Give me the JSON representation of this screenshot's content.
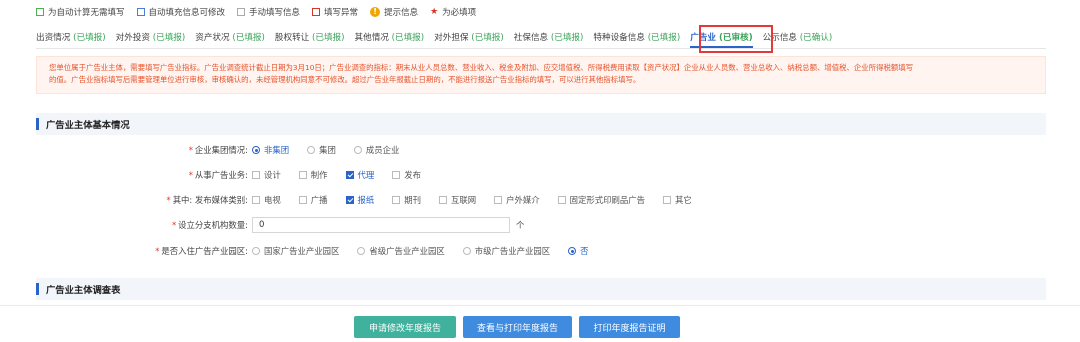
{
  "legend": {
    "auto_calc": "为自动计算无需填写",
    "auto_fill": "自动填充信息可修改",
    "manual": "手动填写信息",
    "error": "填写异常",
    "tip": "提示信息",
    "required": "为必填项"
  },
  "tabs": [
    {
      "name": "出资情况",
      "status": "(已填报)"
    },
    {
      "name": "对外投资",
      "status": "(已填报)"
    },
    {
      "name": "资产状况",
      "status": "(已填报)"
    },
    {
      "name": "股权转让",
      "status": "(已填报)"
    },
    {
      "name": "其他情况",
      "status": "(已填报)"
    },
    {
      "name": "对外担保",
      "status": "(已填报)"
    },
    {
      "name": "社保信息",
      "status": "(已填报)"
    },
    {
      "name": "特种设备信息",
      "status": "(已填报)"
    },
    {
      "name": "广告业",
      "status": "(已审核)"
    },
    {
      "name": "公示信息",
      "status": "(已确认)"
    }
  ],
  "notice": {
    "line1": "您单位属于广告业主体，需要填写广告业指标。广告业调查统计截止日期为3月10日；广告业调查的指标：期末从业人员总数、营业收入、税金及附加、应交增值税、所得税费用读取【资产状况】企业从业人员数、营业总收入、纳税总额、增值税、企业所得税额填写",
    "line2": "的值。广告业指标填写后需要管理单位进行审核，审核确认的，未经管理机构同意不可修改。超过广告业年报截止日期的，不能进行报送广告业指标的填写，可以进行其他指标填写。"
  },
  "section1": {
    "title": "广告业主体基本情况",
    "group": {
      "label": "企业集团情况:",
      "options": [
        "非集团",
        "集团",
        "成员企业"
      ]
    },
    "business": {
      "label": "从事广告业务:",
      "options": [
        "设计",
        "制作",
        "代理",
        "发布"
      ]
    },
    "media": {
      "label": "其中: 发布媒体类别:",
      "options": [
        "电视",
        "广播",
        "报纸",
        "期刊",
        "互联网",
        "户外媒介",
        "固定形式印刷品广告",
        "其它"
      ]
    },
    "branches": {
      "label": "设立分支机构数量:",
      "value": "0",
      "unit": "个"
    },
    "park": {
      "label": "是否入住广告产业园区:",
      "options": [
        "国家广告业产业园区",
        "省级广告业产业园区",
        "市级广告业产业园区",
        "否"
      ]
    }
  },
  "section2": {
    "title": "广告业主体调查表"
  },
  "footer": {
    "apply": "申请修改年度报告",
    "view_print": "查看与打印年度报告",
    "print_cert": "打印年度报告证明"
  }
}
